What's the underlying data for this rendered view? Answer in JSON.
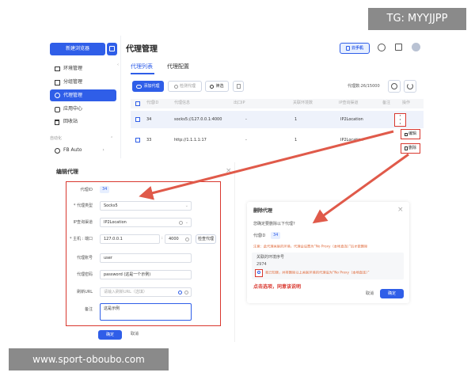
{
  "watermark_top": "TG: MYYJJPP",
  "watermark_bottom": "www.sport-oboubo.com",
  "sidebar": {
    "new_browser_button": "新建浏览器",
    "items": [
      {
        "label": "环境管理"
      },
      {
        "label": "分组管理"
      },
      {
        "label": "代理管理"
      },
      {
        "label": "应用中心"
      },
      {
        "label": "回收站"
      }
    ],
    "section_label": "自动化",
    "fb_item": "FB Auto"
  },
  "header": {
    "title": "代理管理",
    "badge": "云手机"
  },
  "tabs": [
    "代理列表",
    "代理配置"
  ],
  "toolbar": {
    "add_proxy": "添加代理",
    "check_proxy": "检测代理",
    "filter": "筛选",
    "count": "代理数:26/15000"
  },
  "table": {
    "headers": [
      "代理ID",
      "代理信息",
      "出口IP",
      "关联环境数",
      "IP查询渠道",
      "备注",
      "操作"
    ],
    "rows": [
      {
        "id": "34",
        "info": "socks5://127.0.0.1:4000",
        "ip": "-",
        "count": "1",
        "channel": "IP2Location"
      },
      {
        "id": "33",
        "info": "http://1.1.1.1:17",
        "ip": "-",
        "count": "1",
        "channel": "IP2Location"
      }
    ],
    "action_edit": "编辑",
    "action_delete": "删除"
  },
  "edit_modal": {
    "title": "编辑代理",
    "fields": [
      {
        "label": "代理ID",
        "value": "34"
      },
      {
        "label": "* 代理类型",
        "value": "Socks5"
      },
      {
        "label": "IP查询渠道",
        "value": "IP2Location"
      },
      {
        "label": "* 主机 : 端口",
        "value": "127.0.0.1",
        "port": "4000",
        "check": "检查代理"
      },
      {
        "label": "代理账号",
        "value": "user"
      },
      {
        "label": "代理密码",
        "value": "password (这是一个示例)"
      },
      {
        "label": "刷新URL",
        "value": "请输入刷新URL（选填）"
      },
      {
        "label": "备注",
        "value": "这是示例"
      }
    ],
    "confirm": "确定",
    "cancel": "取消"
  },
  "delete_modal": {
    "title": "删除代理",
    "question": "您确定要删除以下代理?",
    "id_label": "代理ID",
    "id_value": "34",
    "warning": "注意：此代理关联的环境，代理会设置为“No Proxy（本地直连）”后才能删除",
    "env_label": "关联的环境序号",
    "env_value": "2974",
    "checkbox_text": "我已知晓，并将删除以上关联环境的代理设为“No Proxy（本地直连）”",
    "annotation": "点击选项，同意该说明",
    "cancel": "取消",
    "confirm": "确定"
  },
  "colors": {
    "accent": "#2f5ee8",
    "annotation_red": "#d9382f",
    "arrow_red": "#e05a4a"
  }
}
